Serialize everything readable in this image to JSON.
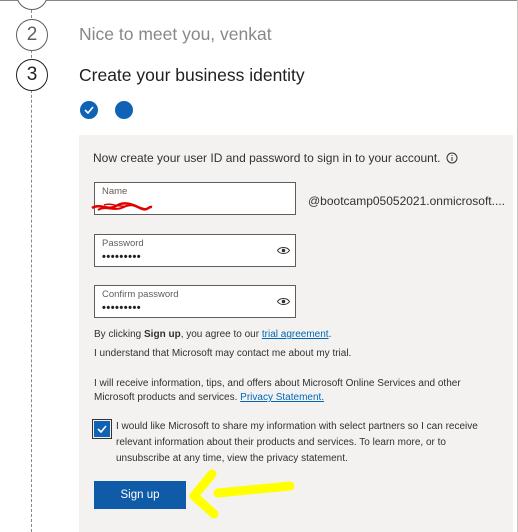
{
  "steps": [
    {
      "number": "2",
      "title": "Nice to meet you, venkat"
    },
    {
      "number": "3",
      "title": "Create your business identity"
    }
  ],
  "progress": {
    "dots_total": 2,
    "dots_complete": 1
  },
  "form": {
    "intro": "Now create your user ID and password to sign in to your account.",
    "name_label": "Name",
    "domain_suffix": "@bootcamp05052021.onmicrosoft....",
    "password_label": "Password",
    "password_value": "•••••••••",
    "confirm_label": "Confirm password",
    "confirm_value": "•••••••••",
    "agree_prefix": "By clicking ",
    "agree_bold": "Sign up",
    "agree_middle": ", you agree to our ",
    "agree_link": "trial agreement",
    "agree_suffix": ".",
    "contact_text": "I understand that Microsoft may contact me about my trial.",
    "info_text": "I will receive information, tips, and offers about Microsoft Online Services and other Microsoft products and services. ",
    "info_link": "Privacy Statement.",
    "share_checkbox_checked": true,
    "share_text": "I would like Microsoft to share my information with select partners so I can receive relevant information about their products and services. To learn more, or to unsubscribe at any time, view the privacy statement.",
    "signup_label": "Sign up"
  },
  "colors": {
    "accent": "#0f62b5",
    "link": "#0067b8",
    "panel": "#f3f2f1",
    "annotation_arrow": "#ffff00",
    "redaction": "#e00000"
  },
  "icons": {
    "info": "info-icon",
    "reveal": "eye-icon",
    "check": "checkmark-icon"
  }
}
